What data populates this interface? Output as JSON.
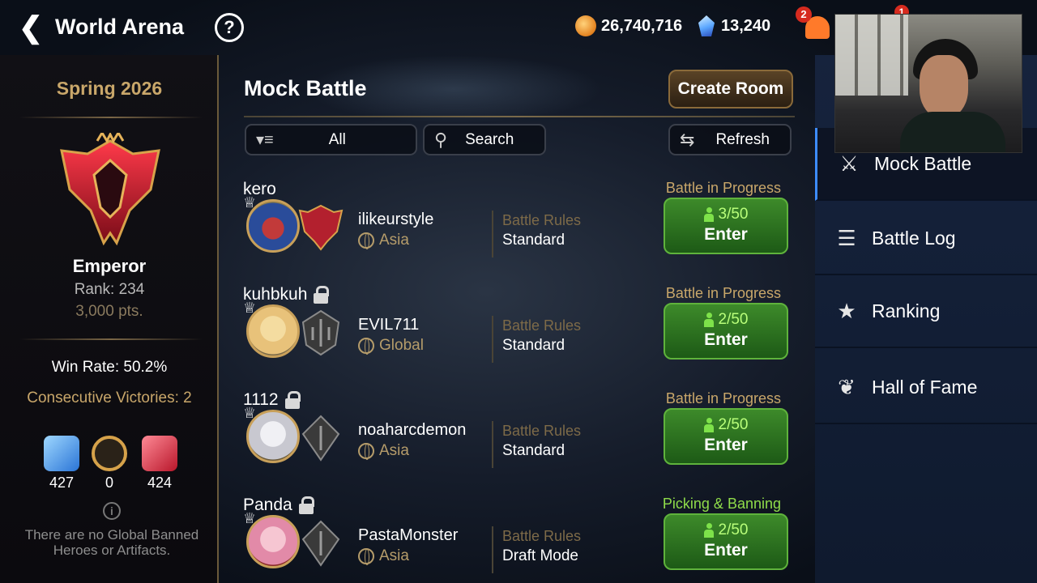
{
  "header": {
    "title": "World Arena",
    "gold": "26,740,716",
    "gems": "13,240",
    "notification_count": "2",
    "secondary_badge": "1"
  },
  "left_panel": {
    "season": "Spring 2026",
    "tier": "Emperor",
    "rank": "Rank: 234",
    "points": "3,000 pts.",
    "win_rate": "Win Rate: 50.2%",
    "consecutive_victories": "Consecutive Victories: 2",
    "stats": [
      {
        "icon": "blue-swords-icon",
        "value": "427"
      },
      {
        "icon": "draw-icon",
        "value": "0"
      },
      {
        "icon": "red-swords-icon",
        "value": "424"
      }
    ],
    "banned_note": "There are no Global Banned Heroes or Artifacts."
  },
  "main": {
    "title": "Mock Battle",
    "create_room": "Create Room",
    "filter": "All",
    "search": "Search",
    "refresh": "Refresh",
    "rules_label": "Battle Rules",
    "enter_label": "Enter",
    "rooms": [
      {
        "name": "kero",
        "locked": false,
        "host": "ilikeurstyle",
        "region": "Asia",
        "rules": "Standard",
        "status": "Battle in Progress",
        "players": "3/50",
        "status_color": "#c9a76a"
      },
      {
        "name": "kuhbkuh",
        "locked": true,
        "host": "EVIL711",
        "region": "Global",
        "rules": "Standard",
        "status": "Battle in Progress",
        "players": "2/50",
        "status_color": "#c9a76a"
      },
      {
        "name": "1112",
        "locked": true,
        "host": "noaharcdemon",
        "region": "Asia",
        "rules": "Standard",
        "status": "Battle in Progress",
        "players": "2/50",
        "status_color": "#c9a76a"
      },
      {
        "name": "Panda",
        "locked": true,
        "host": "PastaMonster",
        "region": "Asia",
        "rules": "Draft Mode",
        "status": "Picking & Banning",
        "players": "2/50",
        "status_color": "#8fdc4a"
      }
    ]
  },
  "nav": {
    "items": [
      {
        "label": "Mock Battle",
        "icon": "swords-icon",
        "active": true
      },
      {
        "label": "Battle Log",
        "icon": "clipboard-icon",
        "active": false
      },
      {
        "label": "Ranking",
        "icon": "trophy-icon",
        "active": false
      },
      {
        "label": "Hall of Fame",
        "icon": "laurel-icon",
        "active": false
      }
    ]
  }
}
